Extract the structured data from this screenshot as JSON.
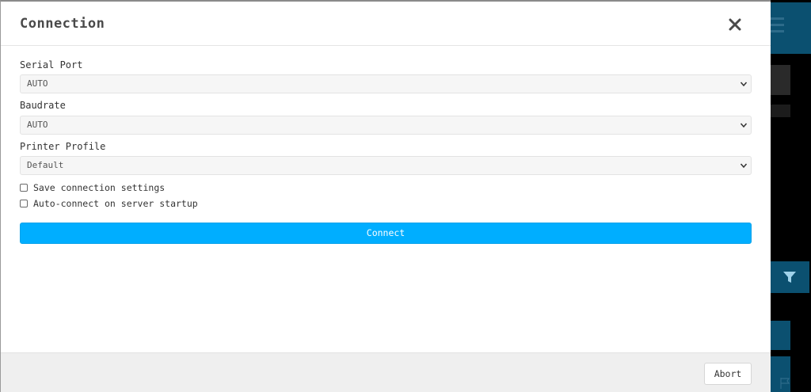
{
  "modal": {
    "title": "Connection",
    "close_icon": "close-icon"
  },
  "form": {
    "serial_port": {
      "label": "Serial Port",
      "value": "AUTO"
    },
    "baudrate": {
      "label": "Baudrate",
      "value": "AUTO"
    },
    "printer_profile": {
      "label": "Printer Profile",
      "value": "Default"
    },
    "save_settings": {
      "label": "Save connection settings",
      "checked": false
    },
    "auto_connect": {
      "label": "Auto-connect on server startup",
      "checked": false
    },
    "connect_label": "Connect"
  },
  "footer": {
    "abort_label": "Abort"
  },
  "colors": {
    "primary": "#00aeff",
    "background_accent": "#0b5070"
  },
  "background_icons": [
    "menu-icon",
    "filter-icon",
    "flag-icon"
  ]
}
